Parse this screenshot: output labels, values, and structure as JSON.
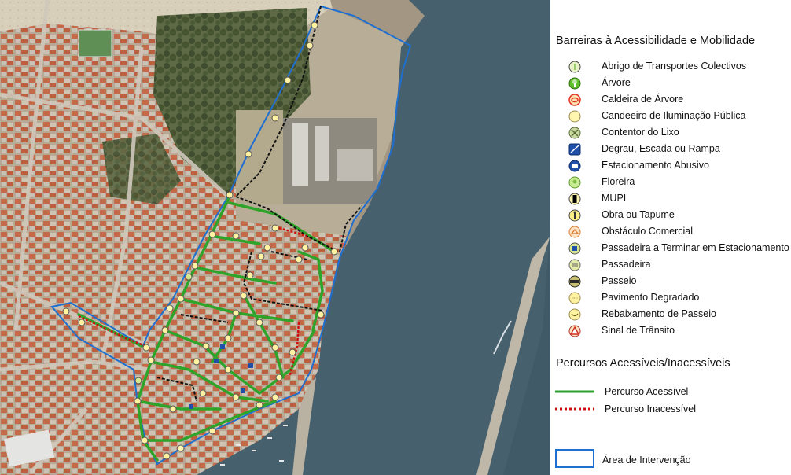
{
  "legend": {
    "barriers_title": "Barreiras à Acessibilidade e Mobilidade",
    "barrier_items": [
      {
        "label": "Abrigo de Transportes Colectivos",
        "icon": "bus-shelter-icon",
        "color": "#c8e6a0"
      },
      {
        "label": "Árvore",
        "icon": "tree-icon",
        "color": "#4caf1a"
      },
      {
        "label": "Caldeira de Árvore",
        "icon": "tree-pit-icon",
        "color": "#e03020"
      },
      {
        "label": "Candeeiro de Iluminação Pública",
        "icon": "street-lamp-icon",
        "color": "#fff6b0"
      },
      {
        "label": "Contentor do Lixo",
        "icon": "trash-container-icon",
        "color": "#8aa050"
      },
      {
        "label": "Degrau, Escada ou Rampa",
        "icon": "stairs-icon",
        "color": "#1f4fa8"
      },
      {
        "label": "Estacionamento Abusivo",
        "icon": "illegal-parking-icon",
        "color": "#1f4fa8"
      },
      {
        "label": "Floreira",
        "icon": "flower-planter-icon",
        "color": "#9ad060"
      },
      {
        "label": "MUPI",
        "icon": "mupi-icon",
        "color": "#000000"
      },
      {
        "label": "Obra ou Tapume",
        "icon": "construction-icon",
        "color": "#fff08a"
      },
      {
        "label": "Obstáculo Comercial",
        "icon": "commercial-obstacle-icon",
        "color": "#f0a060"
      },
      {
        "label": "Passadeira a Terminar em Estacionamento",
        "icon": "crosswalk-parking-icon",
        "color": "#1f4fa8"
      },
      {
        "label": "Passadeira",
        "icon": "crosswalk-icon",
        "color": "#d8e890"
      },
      {
        "label": "Passeio",
        "icon": "sidewalk-icon",
        "color": "#3a3a3a"
      },
      {
        "label": "Pavimento Degradado",
        "icon": "degraded-pavement-icon",
        "color": "#fff2a0"
      },
      {
        "label": "Rebaixamento de Passeio",
        "icon": "curb-ramp-icon",
        "color": "#fff2a0"
      },
      {
        "label": "Sinal de Trânsito",
        "icon": "traffic-sign-icon",
        "color": "#d03020"
      }
    ],
    "routes_title": "Percursos Acessíveis/Inacessíveis",
    "route_items": [
      {
        "label": "Percurso Acessível",
        "icon": "accessible-route-line-icon",
        "color": "#2ca02c"
      },
      {
        "label": "Percurso Inacessível",
        "icon": "inaccessible-route-line-icon",
        "color": "#d01010"
      }
    ],
    "area_item": {
      "label": "Área de Intervenção",
      "icon": "intervention-area-box-icon",
      "color": "#1f6fd0"
    }
  }
}
